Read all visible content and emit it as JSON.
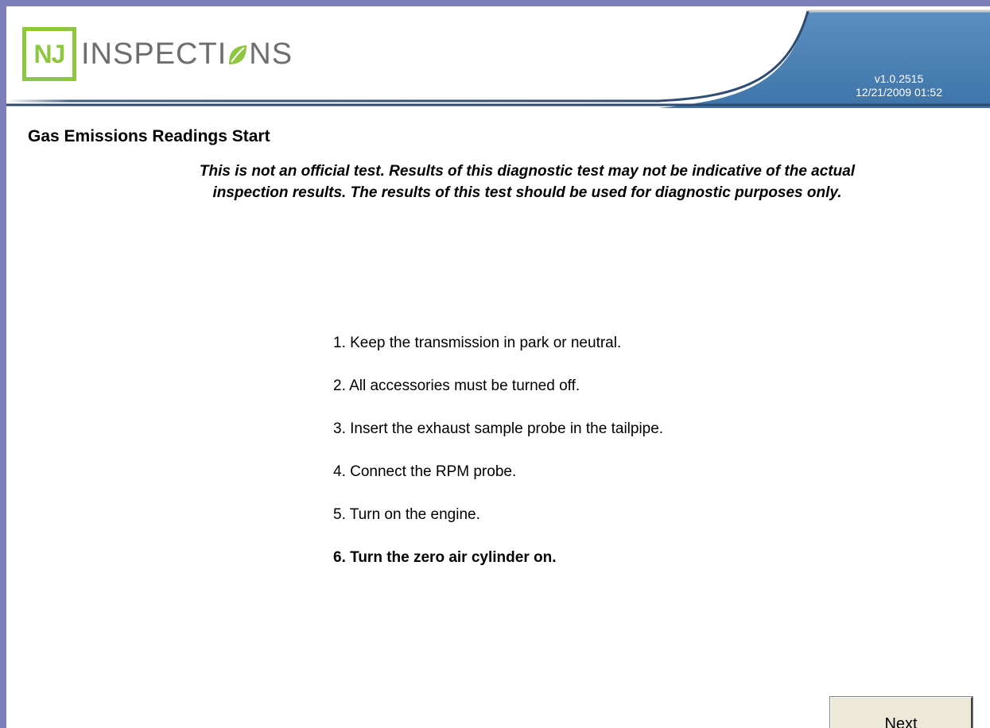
{
  "header": {
    "logo": {
      "box_text": "NJ",
      "text_before": "INSPECTI",
      "text_after": "NS"
    },
    "version": "v1.0.2515",
    "datetime": "12/21/2009 01:52"
  },
  "main": {
    "title": "Gas Emissions Readings Start",
    "disclaimer": "This is not an official test. Results of this diagnostic test may not be indicative of the actual inspection results. The results of this test should be used for diagnostic purposes only.",
    "steps": [
      {
        "text": "1. Keep the transmission in park or neutral.",
        "current": false
      },
      {
        "text": "2. All accessories must be turned off.",
        "current": false
      },
      {
        "text": "3. Insert the exhaust sample probe in the tailpipe.",
        "current": false
      },
      {
        "text": "4. Connect the RPM probe.",
        "current": false
      },
      {
        "text": "5. Turn on the engine.",
        "current": false
      },
      {
        "text": "6. Turn the zero air cylinder on.",
        "current": true
      }
    ]
  },
  "footer": {
    "next_label": "Next"
  },
  "colors": {
    "frame": "#7d7fba",
    "header_blue": "#4a7fb0",
    "logo_green": "#8dc63f",
    "logo_gray": "#6d6e71"
  }
}
